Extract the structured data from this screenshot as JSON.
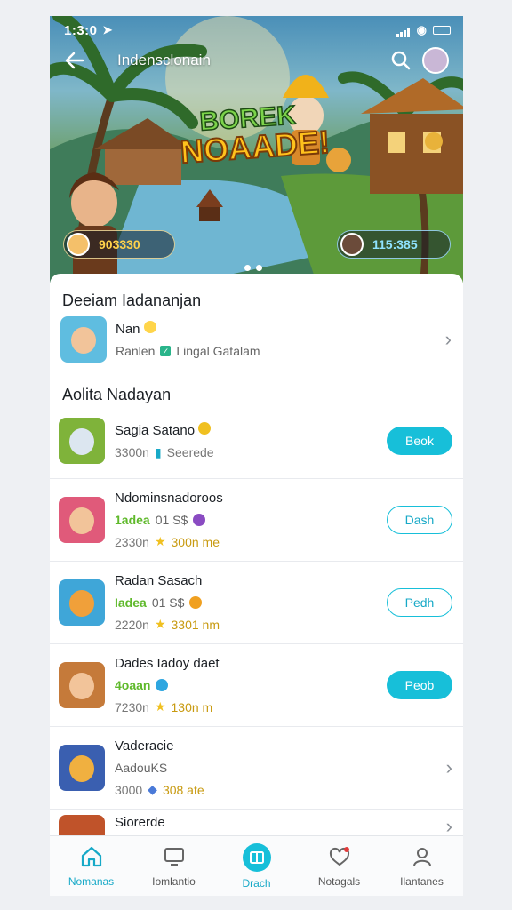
{
  "status_bar": {
    "time": "1:3:0"
  },
  "header": {
    "title": "Indensclonain"
  },
  "banner": {
    "logo_line1": "BOREK",
    "logo_line2": "NOAADE!",
    "left_score": "903330",
    "right_score": "115:385"
  },
  "section1": {
    "title": "Deeiam Iadananjan",
    "profile_name": "Nan",
    "profile_sub1": "Ranlen",
    "profile_sub2": "Lingal Gatalam"
  },
  "section2": {
    "title": "Aolita Nadayan",
    "items": [
      {
        "name": "Sagia Satano",
        "meta1_green": "",
        "meta1_grey": "",
        "meta2_a": "3300n",
        "meta2_b": "Seerede",
        "action": "Beok",
        "action_style": "fill"
      },
      {
        "name": "Ndominsnadoroos",
        "meta1_green": "1adea",
        "meta1_grey": "01 S$",
        "meta2_a": "2330n",
        "meta2_b": "300n me",
        "action": "Dash",
        "action_style": "outline"
      },
      {
        "name": "Radan Sasach",
        "meta1_green": "Iadea",
        "meta1_grey": "01 S$",
        "meta2_a": "2220n",
        "meta2_b": "3301 nm",
        "action": "Pedh",
        "action_style": "outline"
      },
      {
        "name": "Dades Iadoy daet",
        "meta1_green": "4oaan",
        "meta1_grey": "",
        "meta2_a": "7230n",
        "meta2_b": "130n m",
        "action": "Peob",
        "action_style": "fill"
      },
      {
        "name": "Vaderacie",
        "meta1_green": "",
        "meta1_grey": "AadouKS",
        "meta2_a": "3000",
        "meta2_b": "308 ate",
        "action": "",
        "action_style": "chevron"
      },
      {
        "name": "Siorerde",
        "meta1_green": "",
        "meta1_grey": "",
        "meta2_a": "",
        "meta2_b": "",
        "action": "",
        "action_style": "chevron"
      }
    ]
  },
  "bottom_nav": [
    {
      "label": "Nomanas",
      "icon": "home-icon",
      "active": true
    },
    {
      "label": "Iomlantio",
      "icon": "monitor-icon",
      "active": false
    },
    {
      "label": "Drach",
      "icon": "book-icon",
      "active": false
    },
    {
      "label": "Notagals",
      "icon": "notification-icon",
      "active": false
    },
    {
      "label": "Ilantanes",
      "icon": "profile-icon",
      "active": false
    }
  ],
  "colors": {
    "accent": "#17bfd9",
    "green": "#5fb92b",
    "gold": "#c89a10"
  }
}
